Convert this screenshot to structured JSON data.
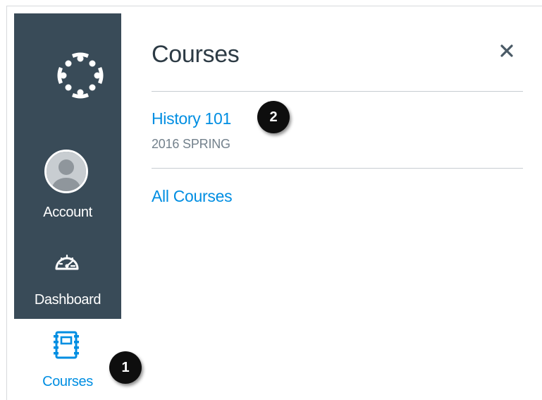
{
  "sidebar": {
    "logo_icon": "canvas-logo-icon",
    "items": [
      {
        "label": "Account",
        "icon": "avatar-icon",
        "active": false
      },
      {
        "label": "Dashboard",
        "icon": "speedometer-icon",
        "active": false
      },
      {
        "label": "Courses",
        "icon": "notebook-icon",
        "active": true
      }
    ]
  },
  "tray": {
    "title": "Courses",
    "close_icon": "close-icon",
    "courses": [
      {
        "name": "History 101",
        "term": "2016 SPRING"
      }
    ],
    "all_courses_label": "All Courses"
  },
  "annotations": {
    "marker_1": "1",
    "marker_2": "2"
  },
  "colors": {
    "sidebar_bg": "#394b58",
    "accent": "#008ee2",
    "title_text": "#2d3b45",
    "muted_text": "#73818c"
  }
}
